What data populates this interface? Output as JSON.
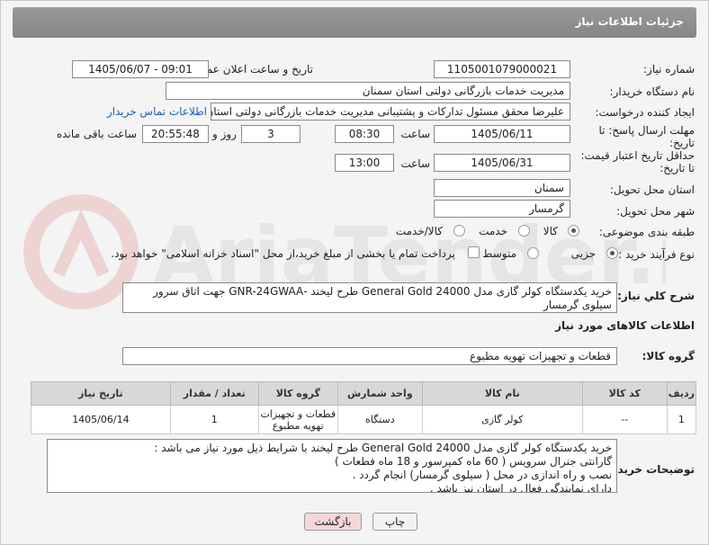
{
  "header": {
    "title": "جزئیات اطلاعات نیاز"
  },
  "fields": {
    "need_number_label": "شماره نیاز:",
    "need_number": "1105001079000021",
    "announce_label": "تاریخ و ساعت اعلان عمومی:",
    "announce_value": "1405/06/07 - 09:01",
    "buyer_org_label": "نام دستگاه خریدار:",
    "buyer_org": "مدیریت خدمات بازرگانی دولتی استان سمنان",
    "creator_label": "ایجاد کننده درخواست:",
    "creator": "علیرضا محقق مسئول تدارکات و پشتیبانی مدیریت خدمات بازرگانی دولتی استان",
    "contact_link": "اطلاعات تماس خریدار",
    "deadline_label_1": "مهلت ارسال پاسخ: تا",
    "deadline_label_2": "تاریخ:",
    "deadline_date": "1405/06/11",
    "time_label": "ساعت",
    "deadline_time": "08:30",
    "days_value": "3",
    "days_label": "روز و",
    "remaining_value": "20:55:48",
    "remaining_label": "ساعت باقی مانده",
    "validity_label_1": "حداقل تاریخ اعتبار قیمت:",
    "validity_label_2": "تا تاریخ:",
    "validity_date": "1405/06/31",
    "validity_time": "13:00",
    "province_label": "استان محل تحویل:",
    "province": "سمنان",
    "city_label": "شهر محل تحویل:",
    "city": "گرمسار",
    "category_label": "طبقه بندی موضوعی:",
    "category_options": [
      "کالا",
      "خدمت",
      "کالا/خدمت"
    ],
    "process_label": "نوع فرآیند خرید :",
    "process_options": [
      "جزیی",
      "متوسط"
    ],
    "payment_note": "پرداخت تمام یا بخشی از مبلغ خرید،از محل \"اسناد خزانه اسلامی\" خواهد بود."
  },
  "description": {
    "label": "شرح کلي نياز:",
    "text": "خرید یکدستگاه کولر گازی مدل General Gold 24000 طرح لیخند -GNR-24GWAA جهت اتاق سرور سیلوی گرمسار"
  },
  "goods": {
    "section_title": "اطلاعات کالاهای مورد نیاز",
    "group_label": "گروه کالا:",
    "group_value": "قطعات و تجهیزات تهویه مطبوع"
  },
  "table": {
    "headers": [
      "ردیف",
      "کد کالا",
      "نام کالا",
      "واحد شمارش",
      "گروه کالا",
      "تعداد / مقدار",
      "تاریخ نیاز"
    ],
    "rows": [
      [
        "1",
        "--",
        "کولر گازی",
        "دستگاه",
        "قطعات و تجهیزات تهویه مطبوع",
        "1",
        "1405/06/14"
      ]
    ]
  },
  "buyer_notes": {
    "label": "توضیحات خریدار:",
    "lines": [
      "خرید یکدستگاه کولر گازی مدل General Gold 24000 طرح لیخند با شرایط ذیل مورد نیاز می باشد :",
      "گارانتی جنرال سرویس ( 60 ماه کمپرسور و 18 ماه قطعات )",
      "نصب و راه اندازی در محل ( سیلوی گرمسار) انجام گردد .",
      "دارای نمایندگی فعال در استان نیز باشد ."
    ]
  },
  "buttons": {
    "print": "چاپ",
    "back": "بازگشت"
  },
  "watermark": "AriaTender.net",
  "colors": {
    "header": "#8f8f8f",
    "link": "#1a5fb4",
    "back_button": "#f6d7d7"
  }
}
